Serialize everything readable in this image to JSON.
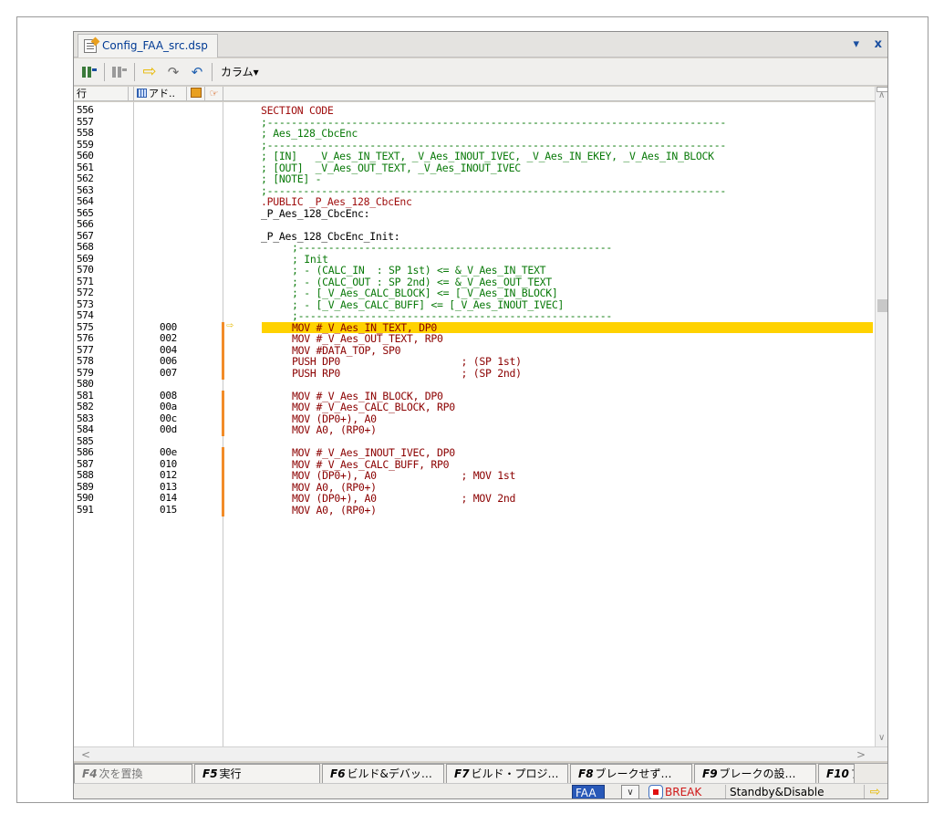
{
  "window": {
    "tab_title": "Config_FAA_src.dsp",
    "pin_glyph": "▾",
    "close_glyph": "x"
  },
  "toolbar": {
    "btn1_glyph": "�1",
    "btn2_glyph": "�1",
    "run_glyph": "⇨",
    "step_glyph": "↷",
    "return_glyph": "↶",
    "column_label": "カラム▾"
  },
  "columns": {
    "line": "行",
    "address": "アド..",
    "pc_glyph": "☞"
  },
  "code_lines": [
    {
      "ln": "556",
      "addr": "",
      "code": "SECTION CODE",
      "cls": "c-dir",
      "bar": false,
      "indent": 0
    },
    {
      "ln": "557",
      "addr": "",
      "code": ";----------------------------------------------------------------------------",
      "cls": "c-cmt",
      "bar": false,
      "indent": 0
    },
    {
      "ln": "558",
      "addr": "",
      "code": "; Aes_128_CbcEnc",
      "cls": "c-cmt",
      "bar": false,
      "indent": 0
    },
    {
      "ln": "559",
      "addr": "",
      "code": ";----------------------------------------------------------------------------",
      "cls": "c-cmt",
      "bar": false,
      "indent": 0
    },
    {
      "ln": "560",
      "addr": "",
      "code": "; [IN]   _V_Aes_IN_TEXT, _V_Aes_INOUT_IVEC, _V_Aes_IN_EKEY, _V_Aes_IN_BLOCK",
      "cls": "c-cmt",
      "bar": false,
      "indent": 0
    },
    {
      "ln": "561",
      "addr": "",
      "code": "; [OUT]  _V_Aes_OUT_TEXT, _V_Aes_INOUT_IVEC",
      "cls": "c-cmt",
      "bar": false,
      "indent": 0
    },
    {
      "ln": "562",
      "addr": "",
      "code": "; [NOTE] -",
      "cls": "c-cmt",
      "bar": false,
      "indent": 0
    },
    {
      "ln": "563",
      "addr": "",
      "code": ";----------------------------------------------------------------------------",
      "cls": "c-cmt",
      "bar": false,
      "indent": 0
    },
    {
      "ln": "564",
      "addr": "",
      "code": ".PUBLIC _P_Aes_128_CbcEnc",
      "cls": "c-dir",
      "bar": false,
      "indent": 0
    },
    {
      "ln": "565",
      "addr": "",
      "code": "_P_Aes_128_CbcEnc:",
      "cls": "c-lbl",
      "bar": false,
      "indent": 0
    },
    {
      "ln": "566",
      "addr": "",
      "code": "",
      "cls": "c-lbl",
      "bar": false,
      "indent": 0
    },
    {
      "ln": "567",
      "addr": "",
      "code": "_P_Aes_128_CbcEnc_Init:",
      "cls": "c-lbl",
      "bar": false,
      "indent": 0
    },
    {
      "ln": "568",
      "addr": "",
      "code": ";----------------------------------------------------",
      "cls": "c-cmt",
      "bar": false,
      "indent": 1
    },
    {
      "ln": "569",
      "addr": "",
      "code": "; Init",
      "cls": "c-cmt",
      "bar": false,
      "indent": 1
    },
    {
      "ln": "570",
      "addr": "",
      "code": "; - (CALC_IN  : SP 1st) <= &_V_Aes_IN_TEXT",
      "cls": "c-cmt",
      "bar": false,
      "indent": 1
    },
    {
      "ln": "571",
      "addr": "",
      "code": "; - (CALC_OUT : SP 2nd) <= &_V_Aes_OUT_TEXT",
      "cls": "c-cmt",
      "bar": false,
      "indent": 1
    },
    {
      "ln": "572",
      "addr": "",
      "code": "; - [_V_Aes_CALC_BLOCK] <= [_V_Aes_IN_BLOCK]",
      "cls": "c-cmt",
      "bar": false,
      "indent": 1
    },
    {
      "ln": "573",
      "addr": "",
      "code": "; - [_V_Aes_CALC_BUFF] <= [_V_Aes_INOUT_IVEC]",
      "cls": "c-cmt",
      "bar": false,
      "indent": 1
    },
    {
      "ln": "574",
      "addr": "",
      "code": ";----------------------------------------------------",
      "cls": "c-cmt",
      "bar": false,
      "indent": 1
    },
    {
      "ln": "575",
      "addr": "000",
      "code": "MOV #_V_Aes_IN_TEXT, DP0",
      "cls": "c-mn",
      "bar": true,
      "indent": 1,
      "current": true
    },
    {
      "ln": "576",
      "addr": "002",
      "code": "MOV #_V_Aes_OUT_TEXT, RP0",
      "cls": "c-mn",
      "bar": true,
      "indent": 1
    },
    {
      "ln": "577",
      "addr": "004",
      "code": "MOV #DATA_TOP, SP0",
      "cls": "c-mn",
      "bar": true,
      "indent": 1
    },
    {
      "ln": "578",
      "addr": "006",
      "code": "PUSH DP0                    ; (SP 1st)",
      "cls": "c-mn",
      "bar": true,
      "indent": 1
    },
    {
      "ln": "579",
      "addr": "007",
      "code": "PUSH RP0                    ; (SP 2nd)",
      "cls": "c-mn",
      "bar": true,
      "indent": 1
    },
    {
      "ln": "580",
      "addr": "",
      "code": "",
      "cls": "c-lbl",
      "bar": false,
      "indent": 0
    },
    {
      "ln": "581",
      "addr": "008",
      "code": "MOV #_V_Aes_IN_BLOCK, DP0",
      "cls": "c-mn",
      "bar": true,
      "indent": 1
    },
    {
      "ln": "582",
      "addr": "00a",
      "code": "MOV #_V_Aes_CALC_BLOCK, RP0",
      "cls": "c-mn",
      "bar": true,
      "indent": 1
    },
    {
      "ln": "583",
      "addr": "00c",
      "code": "MOV (DP0+), A0",
      "cls": "c-mn",
      "bar": true,
      "indent": 1
    },
    {
      "ln": "584",
      "addr": "00d",
      "code": "MOV A0, (RP0+)",
      "cls": "c-mn",
      "bar": true,
      "indent": 1
    },
    {
      "ln": "585",
      "addr": "",
      "code": "",
      "cls": "c-lbl",
      "bar": false,
      "indent": 0
    },
    {
      "ln": "586",
      "addr": "00e",
      "code": "MOV #_V_Aes_INOUT_IVEC, DP0",
      "cls": "c-mn",
      "bar": true,
      "indent": 1
    },
    {
      "ln": "587",
      "addr": "010",
      "code": "MOV #_V_Aes_CALC_BUFF, RP0",
      "cls": "c-mn",
      "bar": true,
      "indent": 1
    },
    {
      "ln": "588",
      "addr": "012",
      "code": "MOV (DP0+), A0              ; MOV 1st",
      "cls": "c-mn",
      "bar": true,
      "indent": 1
    },
    {
      "ln": "589",
      "addr": "013",
      "code": "MOV A0, (RP0+)",
      "cls": "c-mn",
      "bar": true,
      "indent": 1
    },
    {
      "ln": "590",
      "addr": "014",
      "code": "MOV (DP0+), A0              ; MOV 2nd",
      "cls": "c-mn",
      "bar": true,
      "indent": 1
    },
    {
      "ln": "591",
      "addr": "015",
      "code": "MOV A0, (RP0+)",
      "cls": "c-mn",
      "bar": true,
      "indent": 1
    }
  ],
  "fkeys": [
    {
      "key": "F4",
      "label": "次を置換",
      "disabled": true
    },
    {
      "key": "F5",
      "label": "実行",
      "disabled": false
    },
    {
      "key": "F6",
      "label": "ビルド&デバッ…",
      "disabled": false
    },
    {
      "key": "F7",
      "label": "ビルド・プロジ…",
      "disabled": false
    },
    {
      "key": "F8",
      "label": "ブレークせず…",
      "disabled": false
    },
    {
      "key": "F9",
      "label": "ブレークの設…",
      "disabled": false
    },
    {
      "key": "F10",
      "label": "ア",
      "disabled": false
    }
  ],
  "status": {
    "target": "FAA",
    "dropdown_glyph": "∨",
    "break_label": "BREAK",
    "state": "Standby&Disable",
    "go_glyph": "⇨"
  },
  "colors": {
    "current_line": "#ffd200",
    "breakpoint_bar": "#f28c28",
    "comment": "#0a7a0a",
    "mnemonic": "#8b0000"
  }
}
